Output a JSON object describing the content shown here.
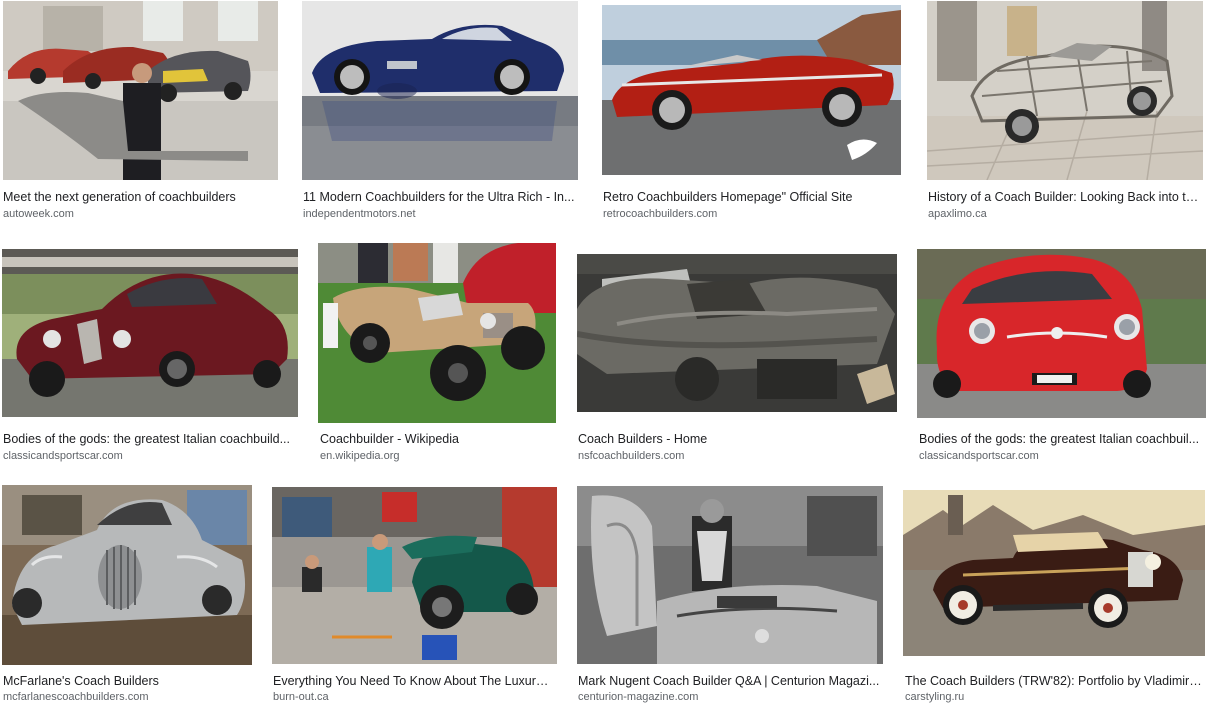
{
  "results": [
    {
      "title": "Meet the next generation of coachbuilders",
      "source": "autoweek.com",
      "alt": "Man holding a metal body panel in a workshop with sports cars"
    },
    {
      "title": "11 Modern Coachbuilders for the Ultra Rich - In...",
      "source": "independentmotors.net",
      "alt": "Dark blue classic coupe on reflective floor"
    },
    {
      "title": "Retro Coachbuilders Homepage\" Official Site",
      "source": "retrocoachbuilders.com",
      "alt": "Red convertible by the sea"
    },
    {
      "title": "History of a Coach Builder: Looking Back into th...",
      "source": "apaxlimo.ca",
      "alt": "Car frame under construction in a shop"
    },
    {
      "title": "Bodies of the gods: the greatest Italian coachbuild...",
      "source": "classicandsportscar.com",
      "alt": "Burgundy vintage streamlined coupe"
    },
    {
      "title": "Coachbuilder - Wikipedia",
      "source": "en.wikipedia.org",
      "alt": "Vintage open roadster with wooden body on grass"
    },
    {
      "title": "Coach Builders - Home",
      "source": "nsfcoachbuilders.com",
      "alt": "Bare metal car body in a garage"
    },
    {
      "title": "Bodies of the gods: the greatest Italian coachbuil...",
      "source": "classicandsportscar.com",
      "alt": "Small red classic coupe front view"
    },
    {
      "title": "McFarlane's Coach Builders",
      "source": "mcfarlanescoachbuilders.com",
      "alt": "Polished aluminium vintage car body"
    },
    {
      "title": "Everything You Need To Know About The Luxury ...",
      "source": "burn-out.ca",
      "alt": "Green race car being restored in a workshop"
    },
    {
      "title": "Mark Nugent Coach Builder Q&A | Centurion Magazi...",
      "source": "centurion-magazine.com",
      "alt": "Craftsman with metal panels black and white"
    },
    {
      "title": "The Coach Builders (TRW'82): Portfolio by Vladimir ...",
      "source": "carstyling.ru",
      "alt": "Illustration of a classic touring car"
    }
  ]
}
